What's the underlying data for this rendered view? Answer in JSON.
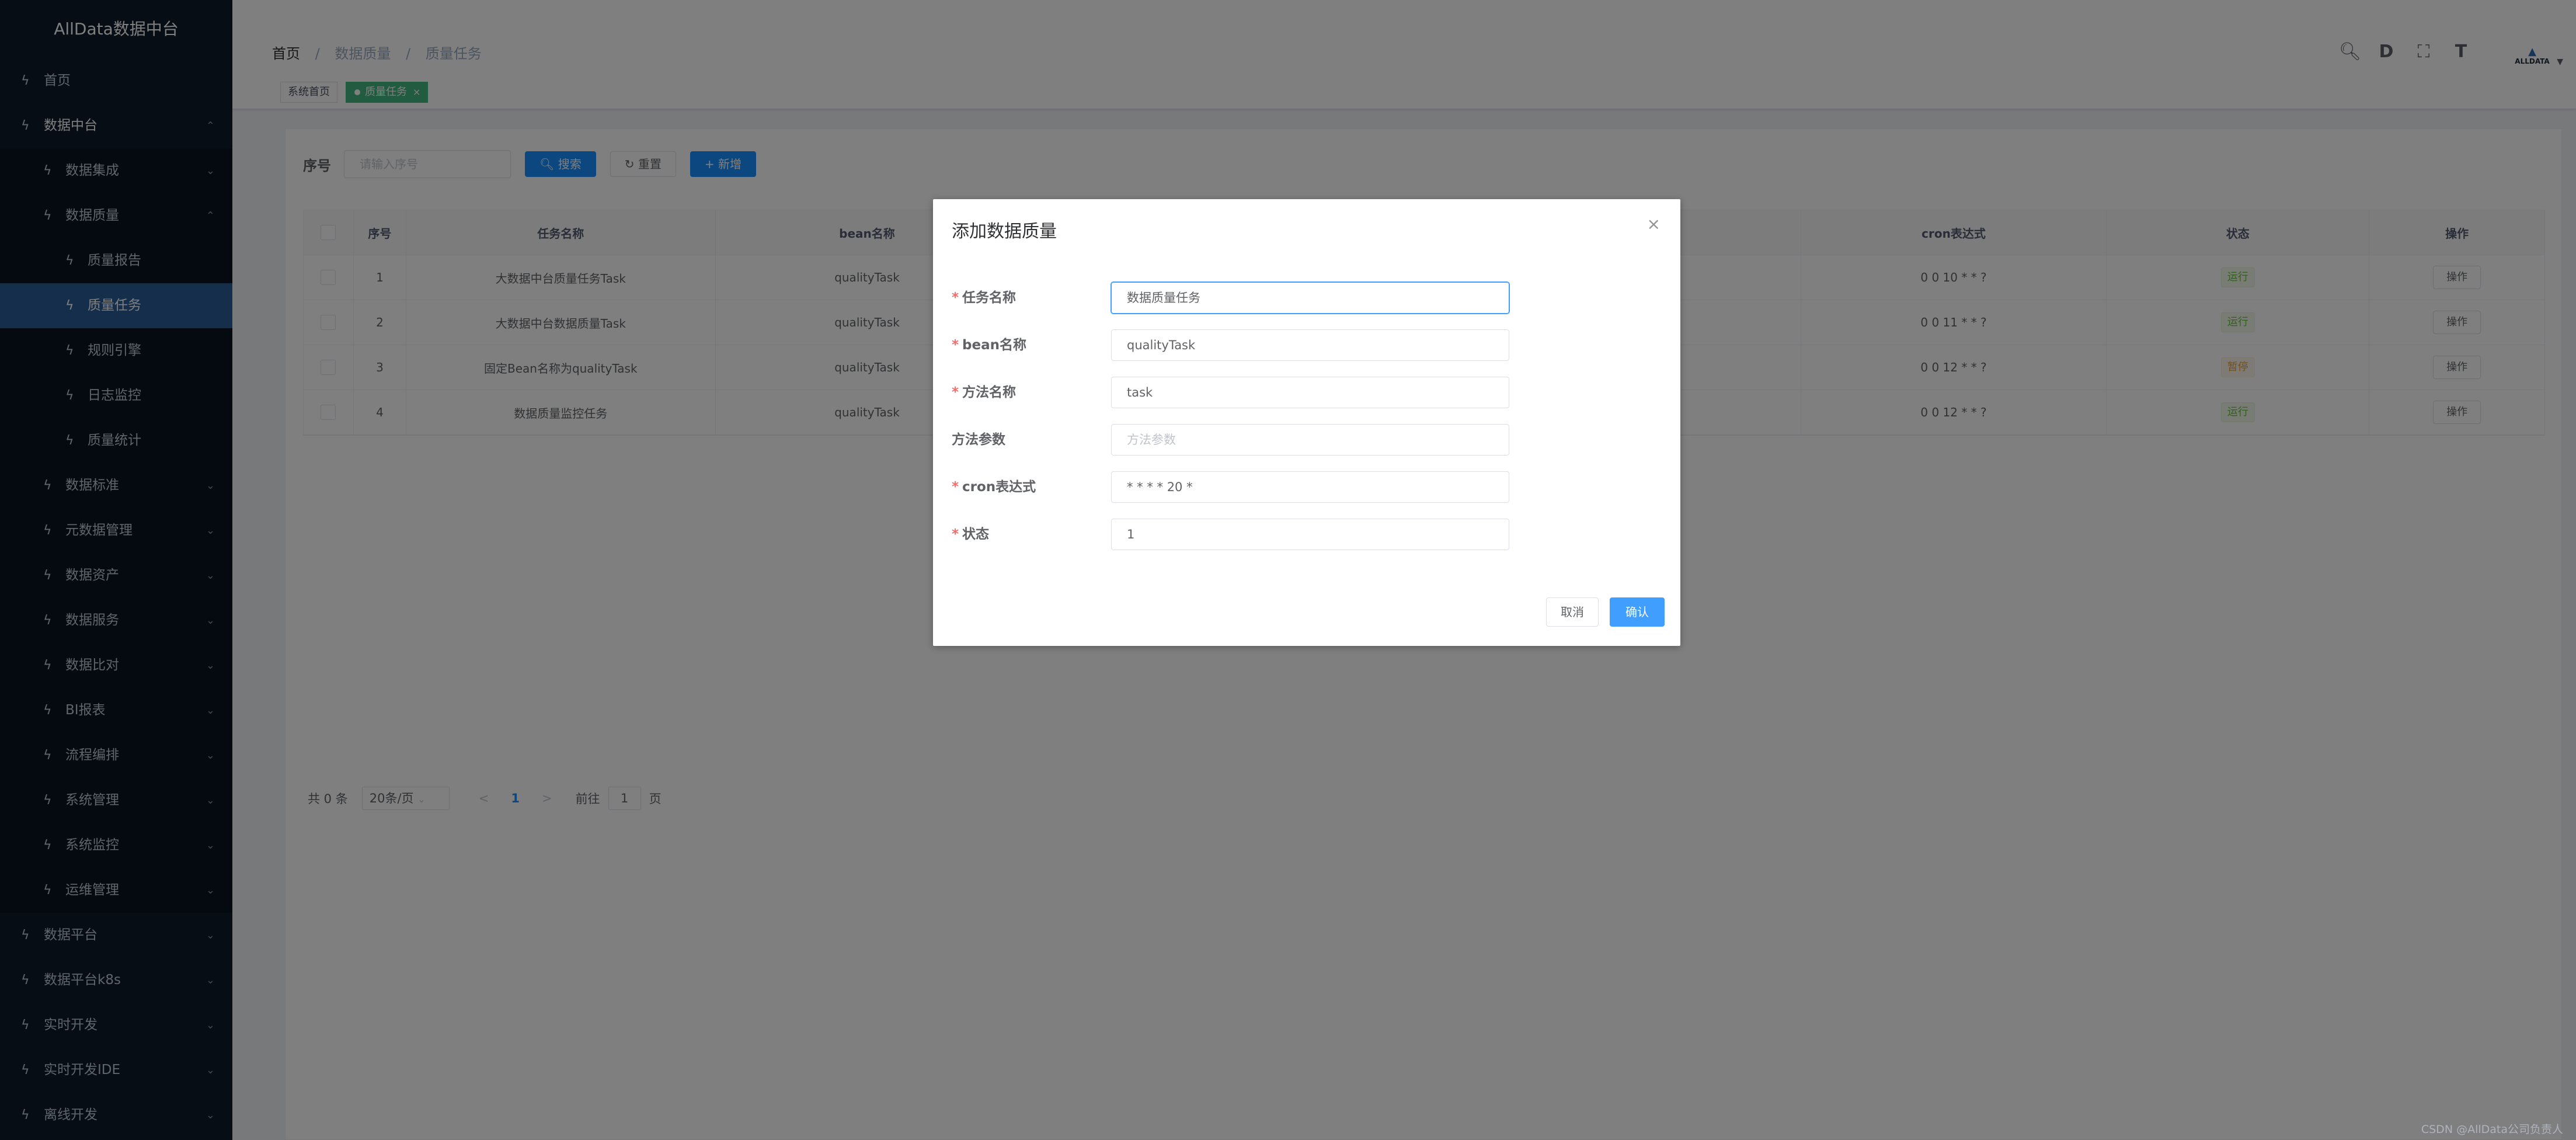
{
  "app": {
    "title": "AllData数据中台"
  },
  "sidebar": {
    "items": [
      {
        "label": "首页",
        "level": 1,
        "state": "leaf"
      },
      {
        "label": "数据中台",
        "level": 1,
        "state": "open"
      },
      {
        "label": "数据集成",
        "level": 2,
        "state": "collapsed"
      },
      {
        "label": "数据质量",
        "level": 2,
        "state": "open"
      },
      {
        "label": "质量报告",
        "level": 3,
        "state": "leaf"
      },
      {
        "label": "质量任务",
        "level": 3,
        "state": "active"
      },
      {
        "label": "规则引擎",
        "level": 3,
        "state": "leaf"
      },
      {
        "label": "日志监控",
        "level": 3,
        "state": "leaf"
      },
      {
        "label": "质量统计",
        "level": 3,
        "state": "leaf"
      },
      {
        "label": "数据标准",
        "level": 2,
        "state": "collapsed"
      },
      {
        "label": "元数据管理",
        "level": 2,
        "state": "collapsed"
      },
      {
        "label": "数据资产",
        "level": 2,
        "state": "collapsed"
      },
      {
        "label": "数据服务",
        "level": 2,
        "state": "collapsed"
      },
      {
        "label": "数据比对",
        "level": 2,
        "state": "collapsed"
      },
      {
        "label": "BI报表",
        "level": 2,
        "state": "collapsed"
      },
      {
        "label": "流程编排",
        "level": 2,
        "state": "collapsed"
      },
      {
        "label": "系统管理",
        "level": 2,
        "state": "collapsed"
      },
      {
        "label": "系统监控",
        "level": 2,
        "state": "collapsed"
      },
      {
        "label": "运维管理",
        "level": 2,
        "state": "collapsed"
      },
      {
        "label": "数据平台",
        "level": 1,
        "state": "collapsed"
      },
      {
        "label": "数据平台k8s",
        "level": 1,
        "state": "collapsed"
      },
      {
        "label": "实时开发",
        "level": 1,
        "state": "collapsed"
      },
      {
        "label": "实时开发IDE",
        "level": 1,
        "state": "collapsed"
      },
      {
        "label": "离线开发",
        "level": 1,
        "state": "collapsed"
      }
    ]
  },
  "breadcrumb": {
    "items": [
      "首页",
      "数据质量",
      "质量任务"
    ]
  },
  "navbar": {
    "tools": [
      "search-icon",
      "document-icon",
      "fullscreen-icon",
      "font-size-icon"
    ],
    "avatar_text": "ALLDATA"
  },
  "tags": {
    "items": [
      {
        "label": "系统首页",
        "active": false
      },
      {
        "label": "质量任务",
        "active": true
      }
    ]
  },
  "search": {
    "label": "序号",
    "placeholder": "请输入序号",
    "search_button": "搜索",
    "reset_button": "重置",
    "add_button": "新增"
  },
  "table": {
    "headers": [
      "序号",
      "任务名称",
      "bean名称",
      "cron表达式",
      "状态",
      "操作"
    ],
    "rows": [
      {
        "seq": "1",
        "name": "大数据中台质量任务Task",
        "bean": "qualityTask",
        "cron": "0 0 10 * * ?",
        "status": "运行",
        "status_type": "running",
        "op": "操作"
      },
      {
        "seq": "2",
        "name": "大数据中台数据质量Task",
        "bean": "qualityTask",
        "cron": "0 0 11 * * ?",
        "status": "运行",
        "status_type": "running",
        "op": "操作"
      },
      {
        "seq": "3",
        "name": "固定Bean名称为qualityTask",
        "bean": "qualityTask",
        "cron": "0 0 12 * * ?",
        "status": "暂停",
        "status_type": "paused",
        "op": "操作"
      },
      {
        "seq": "4",
        "name": "数据质量监控任务",
        "bean": "qualityTask",
        "cron": "0 0 12 * * ?",
        "status": "运行",
        "status_type": "running",
        "op": "操作"
      }
    ]
  },
  "pagination": {
    "total_text": "共 0 条",
    "page_size": "20条/页",
    "prev": "<",
    "current_page": "1",
    "next": ">",
    "jump_prefix": "前往",
    "jump_value": "1",
    "jump_suffix": "页"
  },
  "dialog": {
    "title": "添加数据质量",
    "close": "×",
    "fields": [
      {
        "label": "任务名称",
        "required": true,
        "value": "数据质量任务",
        "placeholder": ""
      },
      {
        "label": "bean名称",
        "required": true,
        "value": "qualityTask",
        "placeholder": ""
      },
      {
        "label": "方法名称",
        "required": true,
        "value": "task",
        "placeholder": ""
      },
      {
        "label": "方法参数",
        "required": false,
        "value": "",
        "placeholder": "方法参数"
      },
      {
        "label": "cron表达式",
        "required": true,
        "value": "* * * * 20 *",
        "placeholder": ""
      },
      {
        "label": "状态",
        "required": true,
        "value": "1",
        "placeholder": ""
      }
    ],
    "cancel_button": "取消",
    "confirm_button": "确认"
  },
  "watermark": "CSDN @AllData公司负责人",
  "colors": {
    "primary": "#1890ff",
    "tag_active": "#42b983",
    "sidebar_bg": "#0f1b29",
    "sidebar_active": "#2a5d97"
  }
}
